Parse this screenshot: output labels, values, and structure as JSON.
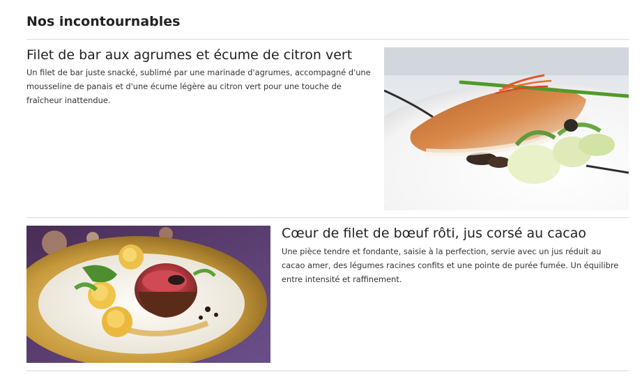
{
  "section": {
    "title": "Nos incontournables"
  },
  "dishes": [
    {
      "title": "Filet de bar aux agrumes et écume de citron vert",
      "description": "Un filet de bar juste snacké, sublimé par une marinade d'agrumes, accompagné d'une mousseline de panais et d'une écume légère au citron vert pour une touche de fraîcheur inattendue.",
      "photo": "fish-fillet-photo"
    },
    {
      "title": "Cœur de filet de bœuf rôti, jus corsé au cacao",
      "description": "Une pièce tendre et fondante, saisie à la perfection, servie avec un jus réduit au cacao amer, des légumes racines confits et une pointe de purée fumée. Un équilibre entre intensité et raffinement.",
      "photo": "beef-fillet-photo"
    }
  ]
}
